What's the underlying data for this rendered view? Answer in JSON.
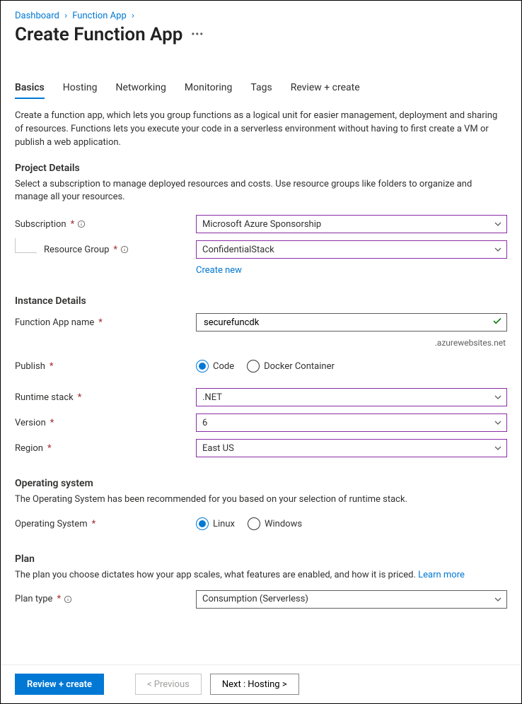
{
  "breadcrumb": {
    "items": [
      "Dashboard",
      "Function App"
    ]
  },
  "page_title": "Create Function App",
  "tabs": [
    "Basics",
    "Hosting",
    "Networking",
    "Monitoring",
    "Tags",
    "Review + create"
  ],
  "selected_tab_index": 0,
  "intro": "Create a function app, which lets you group functions as a logical unit for easier management, deployment and sharing of resources. Functions lets you execute your code in a serverless environment without having to first create a VM or publish a web application.",
  "sections": {
    "project": {
      "heading": "Project Details",
      "desc": "Select a subscription to manage deployed resources and costs. Use resource groups like folders to organize and manage all your resources.",
      "subscription_label": "Subscription",
      "subscription_value": "Microsoft Azure Sponsorship",
      "resource_group_label": "Resource Group",
      "resource_group_value": "ConfidentialStack",
      "create_new": "Create new"
    },
    "instance": {
      "heading": "Instance Details",
      "name_label": "Function App name",
      "name_value": "securefuncdk",
      "domain_suffix": ".azurewebsites.net",
      "publish_label": "Publish",
      "publish_options": [
        "Code",
        "Docker Container"
      ],
      "publish_selected": "Code",
      "runtime_label": "Runtime stack",
      "runtime_value": ".NET",
      "version_label": "Version",
      "version_value": "6",
      "region_label": "Region",
      "region_value": "East US"
    },
    "os": {
      "heading": "Operating system",
      "desc": "The Operating System has been recommended for you based on your selection of runtime stack.",
      "label": "Operating System",
      "options": [
        "Linux",
        "Windows"
      ],
      "selected": "Linux"
    },
    "plan": {
      "heading": "Plan",
      "desc_prefix": "The plan you choose dictates how your app scales, what features are enabled, and how it is priced. ",
      "learn_more": "Learn more",
      "label": "Plan type",
      "value": "Consumption (Serverless)"
    }
  },
  "footer": {
    "review": "Review + create",
    "previous": "< Previous",
    "next": "Next : Hosting >"
  }
}
